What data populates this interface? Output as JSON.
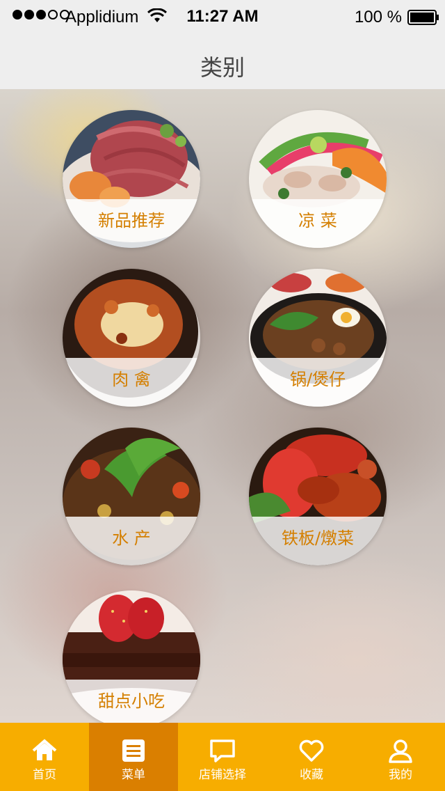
{
  "status_bar": {
    "carrier": "Applidium",
    "time": "11:27 AM",
    "battery": "100 %"
  },
  "nav": {
    "title": "类别"
  },
  "categories": [
    {
      "label": "新品推荐",
      "icon": "noodle-dish-image"
    },
    {
      "label": "凉 菜",
      "icon": "cold-dish-image"
    },
    {
      "label": "肉 禽",
      "icon": "meat-poultry-image"
    },
    {
      "label": "锅/煲仔",
      "icon": "claypot-image"
    },
    {
      "label": "水 产",
      "icon": "seafood-image"
    },
    {
      "label": "铁板/燉菜",
      "icon": "iron-plate-image"
    },
    {
      "label": "甜点小吃",
      "icon": "dessert-image"
    }
  ],
  "tabs": [
    {
      "label": "首页",
      "icon": "home-icon"
    },
    {
      "label": "菜单",
      "icon": "menu-list-icon",
      "active": true
    },
    {
      "label": "店铺选择",
      "icon": "chat-bubble-icon"
    },
    {
      "label": "收藏",
      "icon": "heart-icon"
    },
    {
      "label": "我的",
      "icon": "user-icon"
    }
  ],
  "colors": {
    "accent_text": "#d47f00",
    "tabbar_bg": "#f7ad00",
    "tab_active_bg": "#da7f00",
    "bar_bg": "#eeeeee"
  }
}
